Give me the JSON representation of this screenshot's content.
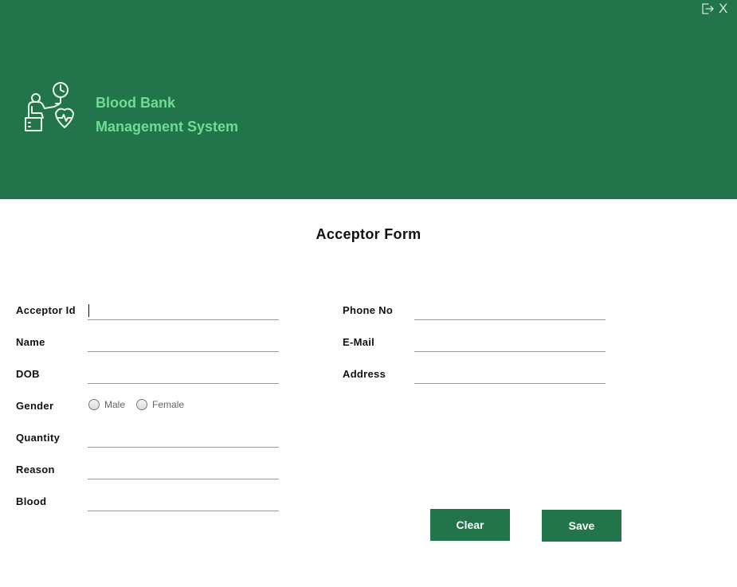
{
  "header": {
    "title_line1": "Blood Bank",
    "title_line2": "Management System",
    "logo_icon": "blood-donation-icon",
    "logout_icon": "logout-icon",
    "close_label": "X"
  },
  "form": {
    "title": "Acceptor Form",
    "fields": {
      "acceptor_id": {
        "label": "Acceptor Id",
        "value": ""
      },
      "name": {
        "label": "Name",
        "value": ""
      },
      "dob": {
        "label": "DOB",
        "value": ""
      },
      "gender": {
        "label": "Gender",
        "options": [
          "Male",
          "Female"
        ],
        "selected": ""
      },
      "quantity": {
        "label": "Quantity",
        "value": ""
      },
      "reason": {
        "label": "Reason",
        "value": ""
      },
      "blood": {
        "label": "Blood",
        "value": ""
      },
      "phone": {
        "label": "Phone No",
        "value": ""
      },
      "email": {
        "label": "E-Mail",
        "value": ""
      },
      "address": {
        "label": "Address",
        "value": ""
      }
    },
    "buttons": {
      "clear": "Clear",
      "save": "Save"
    }
  },
  "colors": {
    "header_bg": "#22754a",
    "title_accent": "#6fdc96",
    "button_bg": "#22754a"
  }
}
